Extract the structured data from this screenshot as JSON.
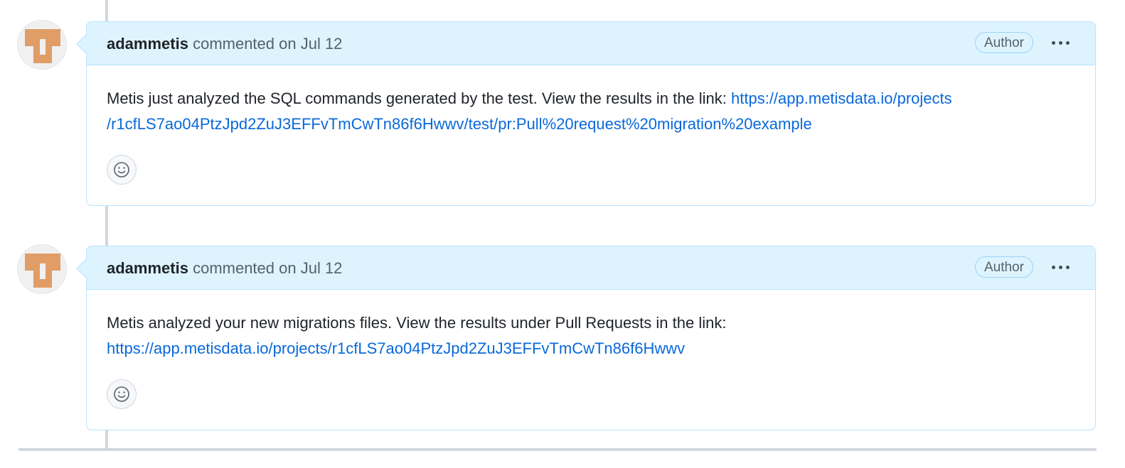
{
  "comments": [
    {
      "author": "adammetis",
      "commented": "commented on Jul 12",
      "badge": "Author",
      "body_text": "Metis just analyzed the SQL commands generated by the test. View the results in the link: ",
      "link_line1": "https://app.metisdata.io/projects",
      "link_line2": "/r1cfLS7ao04PtzJpd2ZuJ3EFFvTmCwTn86f6Hwwv/test/pr:Pull%20request%20migration%20example"
    },
    {
      "author": "adammetis",
      "commented": "commented on Jul 12",
      "badge": "Author",
      "body_text": "Metis analyzed your new migrations files. View the results under Pull Requests in the link:",
      "link": "https://app.metisdata.io/projects/r1cfLS7ao04PtzJpd2ZuJ3EFFvTmCwTn86f6Hwwv"
    }
  ],
  "icons": {
    "more": "kebab-horizontal-icon",
    "reaction": "smiley-icon"
  },
  "colors": {
    "header_bg": "#ddf4ff",
    "border": "#b6e3ff",
    "link": "#0969da",
    "avatar_fill": "#e09d66"
  }
}
